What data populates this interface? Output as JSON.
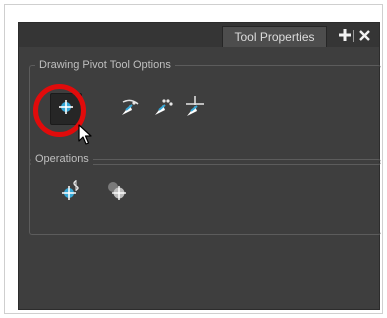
{
  "panel": {
    "tab_title": "Tool Properties",
    "add_tab_icon": "plus-icon",
    "close_icon": "close-icon"
  },
  "drawing_pivot_tool_options": {
    "label": "Drawing Pivot Tool Options",
    "tools": [
      {
        "icon": "pivot-crosshair-icon",
        "selected": true
      },
      {
        "icon": "pivot-line-icon",
        "selected": false
      },
      {
        "icon": "pivot-dots-icon",
        "selected": false
      },
      {
        "icon": "pivot-cross-icon",
        "selected": false
      }
    ]
  },
  "operations": {
    "label": "Operations",
    "buttons": [
      {
        "icon": "reset-pivot-icon"
      },
      {
        "icon": "pivot-target-icon"
      }
    ]
  },
  "annotation": {
    "highlight_color": "#e10b0b",
    "cursor": "mouse-pointer-icon"
  },
  "colors": {
    "panel_bg": "#3e3e3e",
    "icon_blue": "#35a7d6",
    "text": "#dcdcdc"
  }
}
